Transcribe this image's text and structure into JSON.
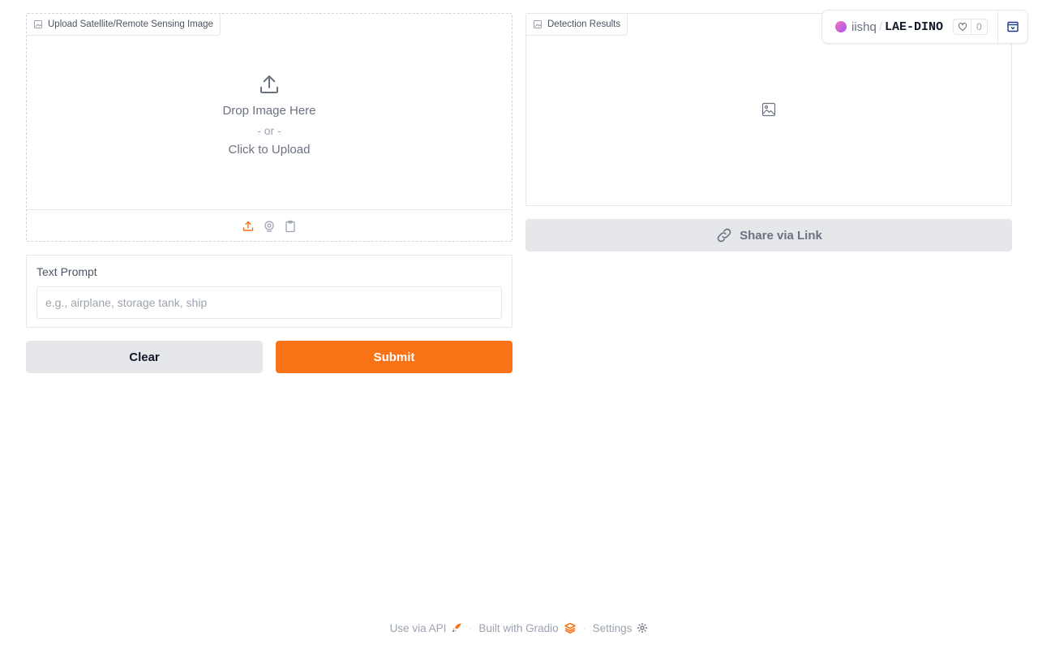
{
  "upload": {
    "label": "Upload Satellite/Remote Sensing Image",
    "drop_text": "Drop Image Here",
    "or_text": "- or -",
    "click_text": "Click to Upload",
    "sources": [
      "upload-icon",
      "webcam-icon",
      "clipboard-icon"
    ]
  },
  "results": {
    "label": "Detection Results",
    "share_label": "Share via Link"
  },
  "prompt": {
    "label": "Text Prompt",
    "placeholder": "e.g., airplane, storage tank, ship",
    "value": ""
  },
  "actions": {
    "clear_label": "Clear",
    "submit_label": "Submit"
  },
  "space": {
    "owner": "iishq",
    "separator": "/",
    "name": "LAE-DINO",
    "likes": "0"
  },
  "footer": {
    "api_label": "Use via API",
    "built_label": "Built with Gradio",
    "settings_label": "Settings",
    "separator": "·"
  },
  "colors": {
    "accent": "#f97316",
    "neutral_button": "#e5e7eb"
  }
}
